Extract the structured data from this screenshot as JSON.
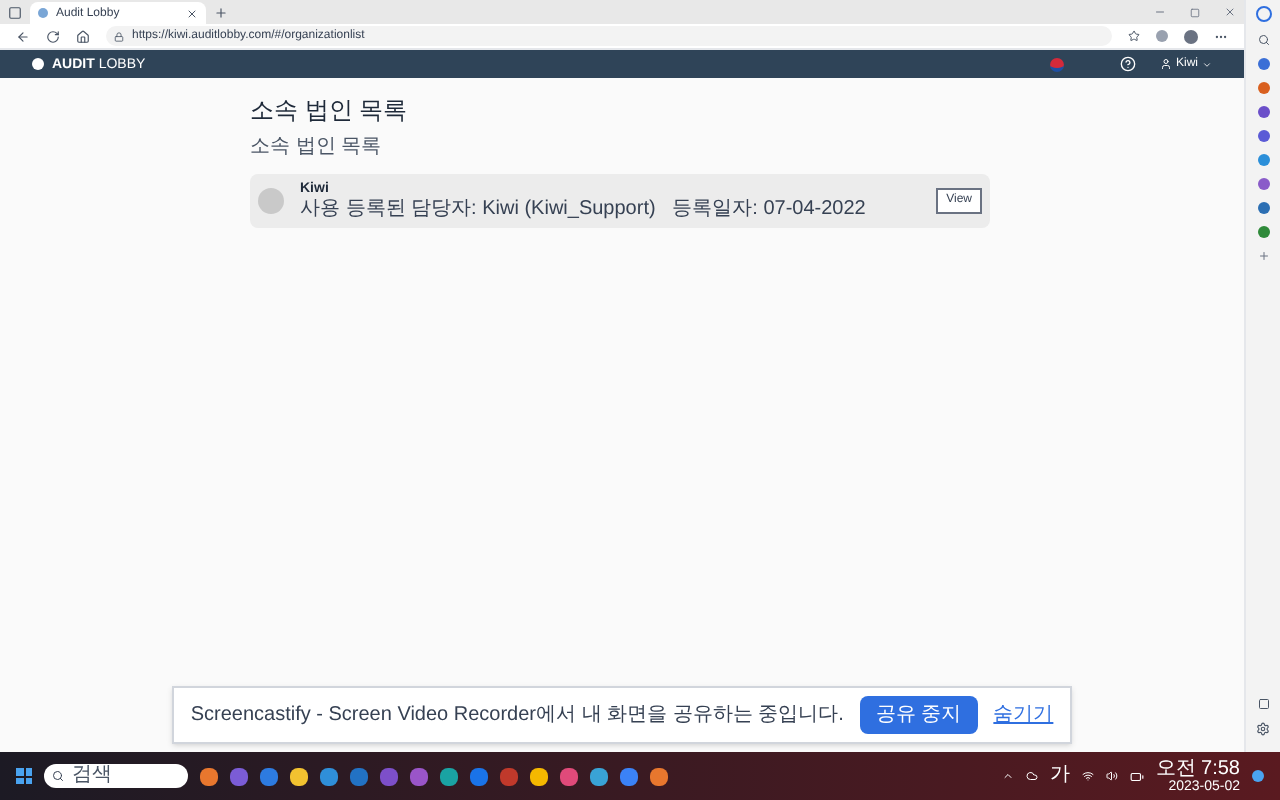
{
  "browser": {
    "tab": {
      "title": "Audit Lobby"
    },
    "url": "https://kiwi.auditlobby.com/#/organizationlist"
  },
  "site_header": {
    "logo": "**AUDIT** LOBBY",
    "user": "Kiwi"
  },
  "page": {
    "title": "소속 법인 목록",
    "subtitle": "소속 법인 목록"
  },
  "organizations": [
    {
      "name": "Kiwi",
      "detail": "사용 등록된 담당자: Kiwi (Kiwi_Support)   등록일자: 07-04-2022",
      "action": "View"
    }
  ],
  "share_bar": {
    "message": "Screencastify - Screen Video Recorder에서 내 화면을 공유하는 중입니다.",
    "stop": "공유 중지",
    "hide": "숨기기"
  },
  "taskbar": {
    "search_placeholder": "검색",
    "ime": "가",
    "time": "오전 7:58",
    "date": "2023-05-02"
  }
}
